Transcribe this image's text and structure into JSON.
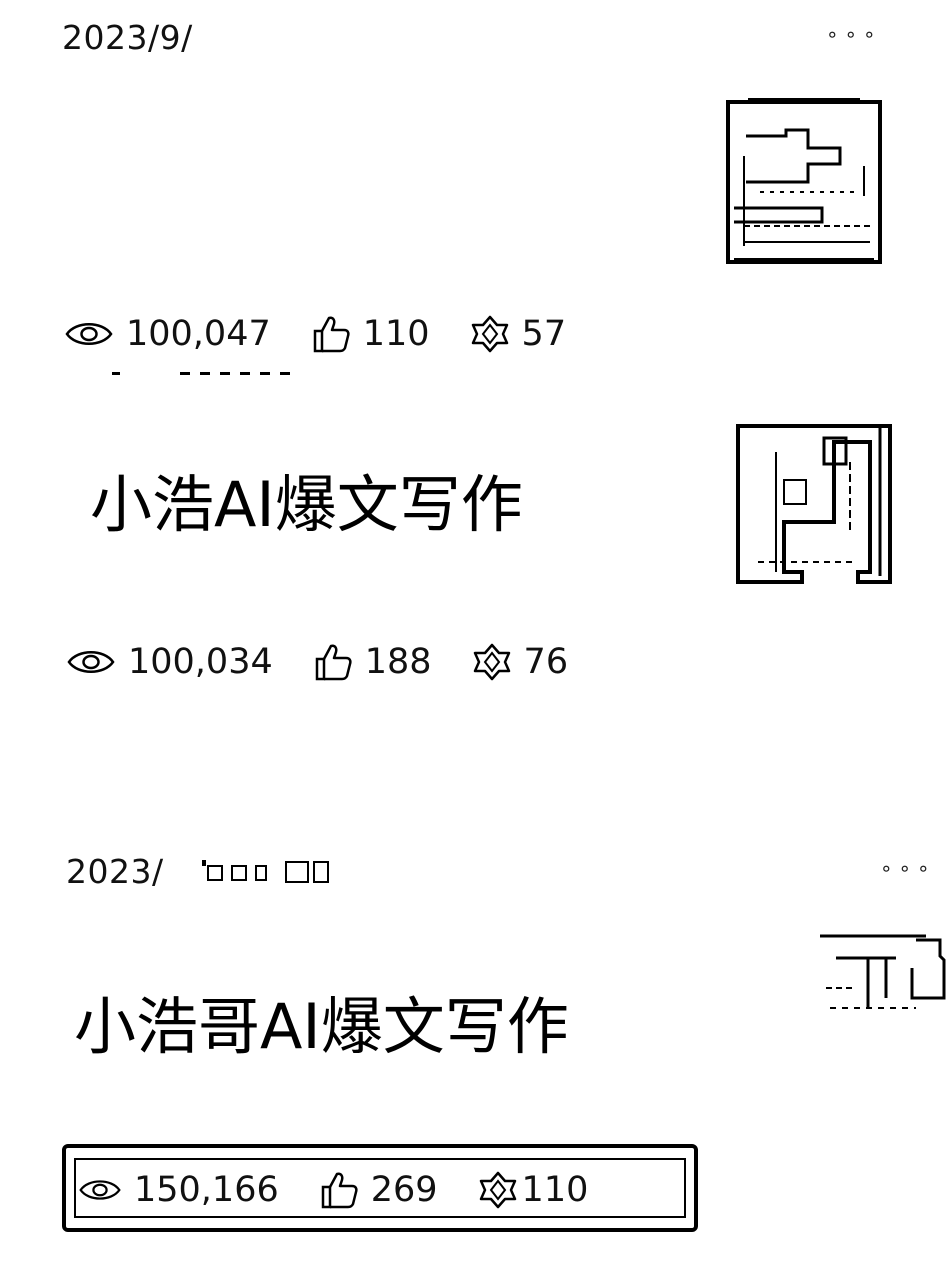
{
  "posts": [
    {
      "date": "2023/9/",
      "more_label": "∘∘∘",
      "title": "",
      "stats": {
        "views": "100,047",
        "likes": "110",
        "shares": "57"
      }
    },
    {
      "date": "",
      "more_label": "",
      "title": "小浩AI爆文写作",
      "stats": {
        "views": "100,034",
        "likes": "188",
        "shares": "76"
      }
    },
    {
      "date": "2023/",
      "more_label": "∘∘∘",
      "title": "小浩哥AI爆文写作",
      "stats": {
        "views": "150,166",
        "likes": "269",
        "shares": "110"
      }
    }
  ],
  "icons": {
    "views": "eye-icon",
    "likes": "thumbs-up-icon",
    "shares": "share-icon",
    "more": "more-dots-icon"
  },
  "colors": {
    "background": "#ffffff",
    "text": "#000000"
  }
}
